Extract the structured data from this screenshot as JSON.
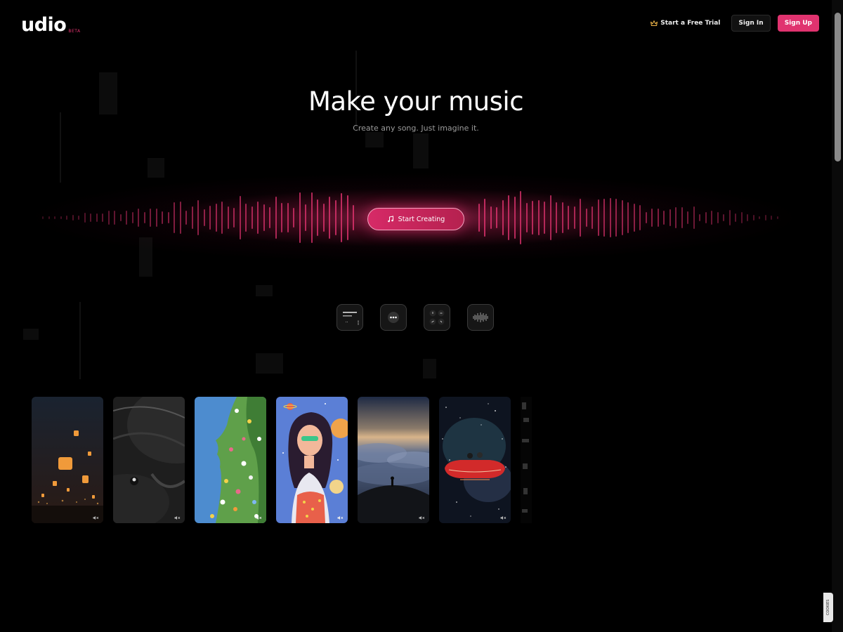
{
  "header": {
    "logo_text": "udio",
    "logo_badge": "BETA",
    "trial_label": "Start a Free Trial",
    "signin_label": "Sign In",
    "signup_label": "Sign Up"
  },
  "hero": {
    "title": "Make your music",
    "subtitle": "Create any song. Just imagine it.",
    "cta_label": "Start Creating"
  },
  "features": [
    {
      "icon": "text-prompt-icon"
    },
    {
      "icon": "more-options-icon"
    },
    {
      "icon": "controls-icon"
    },
    {
      "icon": "audio-waveform-icon"
    }
  ],
  "cards": [
    {
      "icon": "mute-icon",
      "theme": "lanterns"
    },
    {
      "icon": "mute-icon",
      "theme": "vinyl"
    },
    {
      "icon": "mute-icon",
      "theme": "flower-face"
    },
    {
      "icon": "mute-icon",
      "theme": "space-girl"
    },
    {
      "icon": "mute-icon",
      "theme": "clouds"
    },
    {
      "icon": "mute-icon",
      "theme": "space-car"
    }
  ],
  "cookie_label": "COOKIES",
  "colors": {
    "accent": "#e0336f",
    "background": "#000000",
    "muted_text": "#9a9a9a"
  }
}
